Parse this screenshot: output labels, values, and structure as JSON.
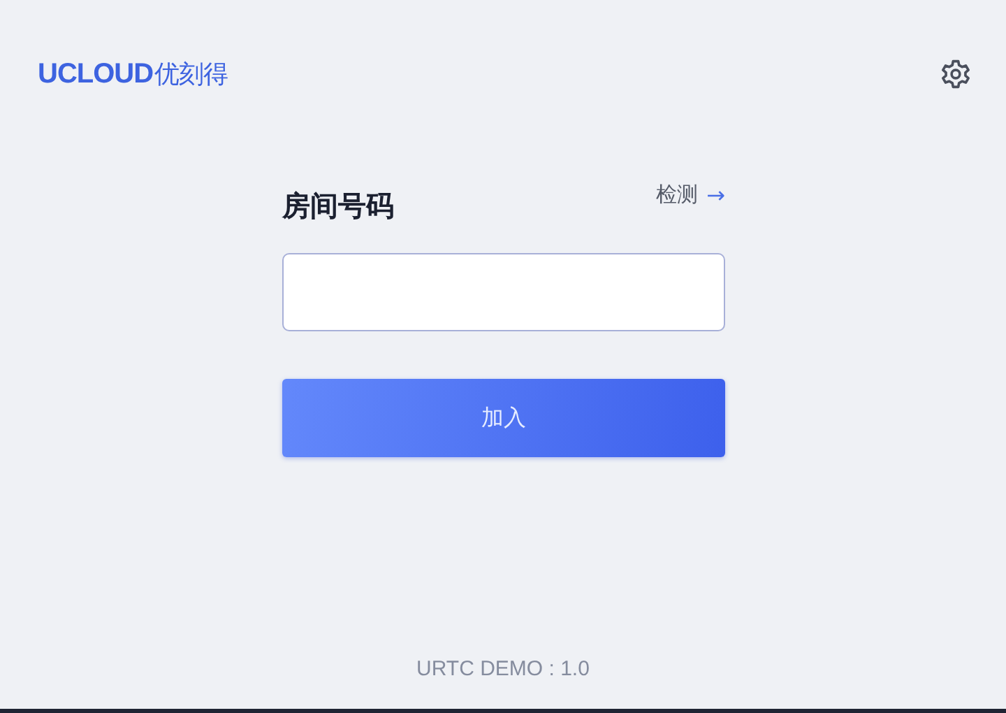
{
  "logo": {
    "text": "UCLOUD",
    "suffix": "优刻得"
  },
  "form": {
    "title": "房间号码",
    "check_link": "检测",
    "check_arrow": "→",
    "join_button": "加入"
  },
  "footer": "URTC DEMO : 1.0"
}
